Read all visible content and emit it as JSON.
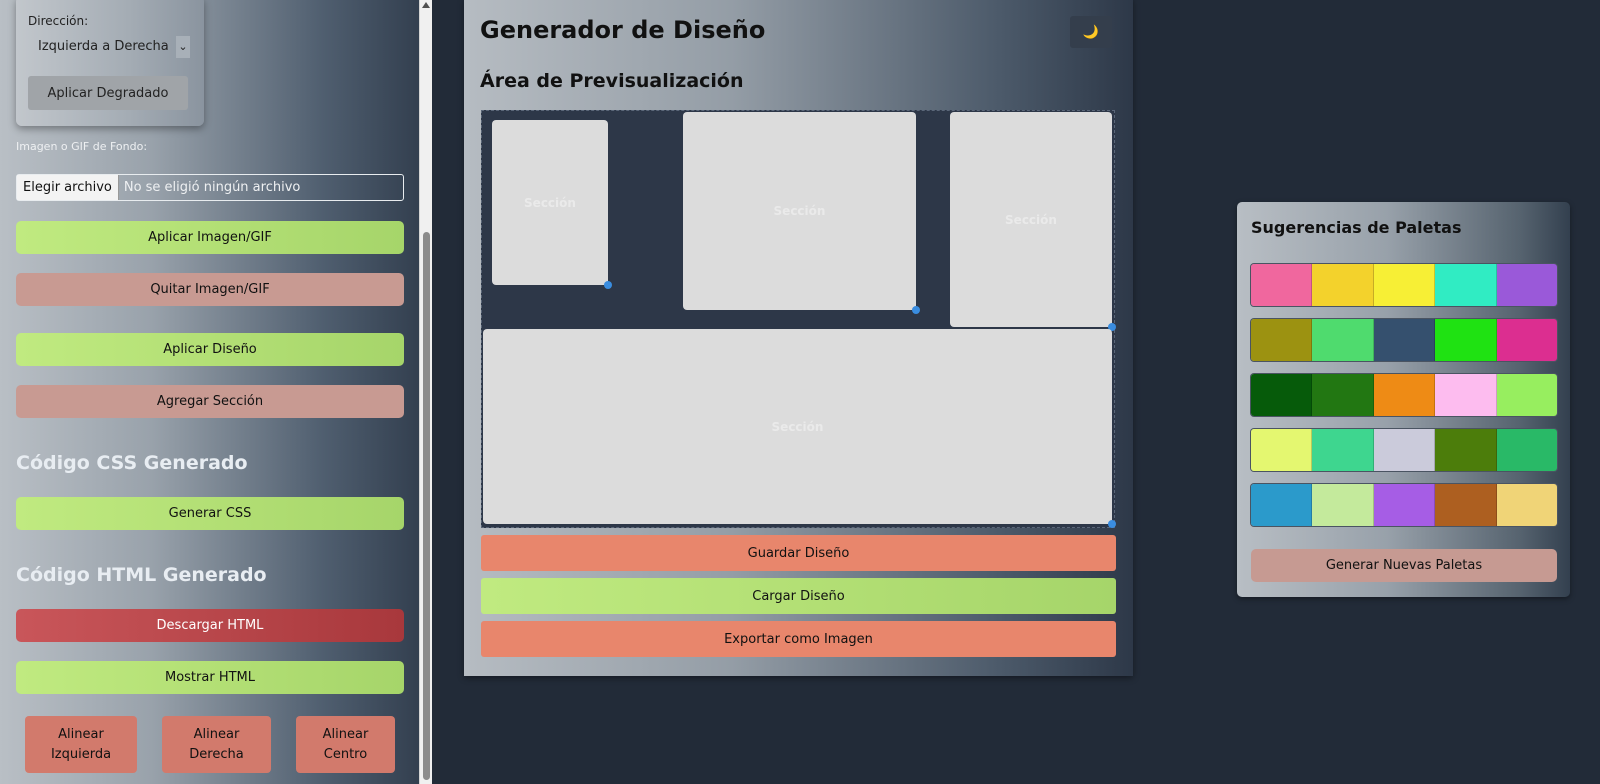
{
  "sidebar": {
    "gradient": {
      "direction_label": "Dirección:",
      "direction_value": "Izquierda a Derecha",
      "apply_button": "Aplicar Degradado"
    },
    "background_label": "Imagen o GIF de Fondo:",
    "file_button": "Elegir archivo",
    "file_status": "No se eligió ningún archivo",
    "apply_image_button": "Aplicar Imagen/GIF",
    "remove_image_button": "Quitar Imagen/GIF",
    "apply_design_button": "Aplicar Diseño",
    "add_section_button": "Agregar Sección",
    "css_title": "Código CSS Generado",
    "generate_css_button": "Generar CSS",
    "html_title": "Código HTML Generado",
    "download_html_button": "Descargar HTML",
    "show_html_button": "Mostrar HTML",
    "align": {
      "left": "Alinear\nIzquierda",
      "right": "Alinear\nDerecha",
      "center": "Alinear\nCentro"
    }
  },
  "main": {
    "title": "Generador de Diseño",
    "theme_toggle_icon": "moon-icon",
    "theme_toggle_glyph": "🌙",
    "preview_title": "Área de Previsualización",
    "sections": [
      "Sección",
      "Sección",
      "Sección",
      "Sección"
    ],
    "save_button": "Guardar Diseño",
    "load_button": "Cargar Diseño",
    "export_button": "Exportar como Imagen"
  },
  "palettes": {
    "title": "Sugerencias de Paletas",
    "rows": [
      [
        "#f0679e",
        "#f3d22c",
        "#f7ef35",
        "#30ecc3",
        "#9a59d9"
      ],
      [
        "#9c9211",
        "#4fdb6e",
        "#35506e",
        "#1fe212",
        "#dc2e90"
      ],
      [
        "#065b0a",
        "#227712",
        "#ee8b15",
        "#fdbcef",
        "#97ee5f"
      ],
      [
        "#e4f770",
        "#3ed68f",
        "#cbcbdb",
        "#4c7d0b",
        "#29b967"
      ],
      [
        "#2b9acb",
        "#c4ea9c",
        "#a65de5",
        "#ad5f20",
        "#f0d477"
      ]
    ],
    "generate_button": "Generar Nuevas Paletas"
  },
  "colors": {
    "green_button": "#b3e074",
    "pink_button": "#c89a92",
    "red_button": "#b9484b",
    "salmon_button": "#e8866c",
    "page_background": "#222b38"
  }
}
